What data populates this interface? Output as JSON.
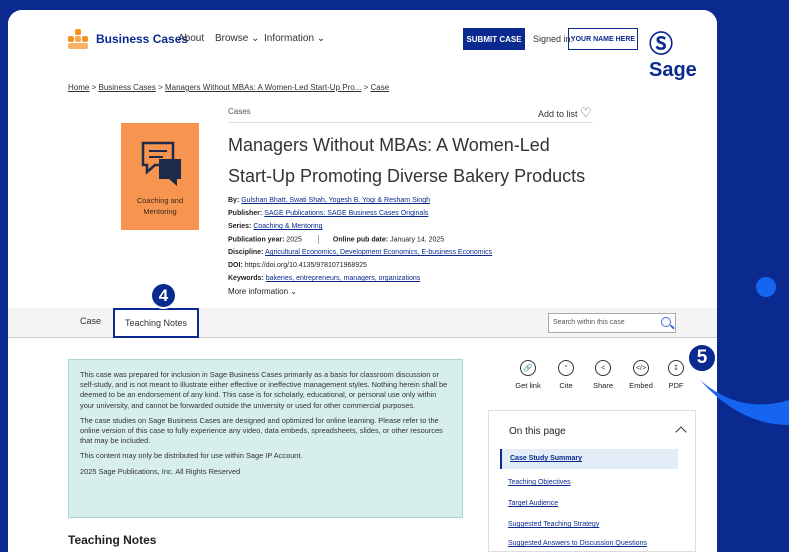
{
  "header": {
    "brand": "Business Cases",
    "nav": [
      "About",
      "Browse",
      "Information"
    ],
    "submit_label": "SUBMIT CASE",
    "signed_in_label": "Signed in:",
    "user_button": "YOUR NAME HERE",
    "sage_logo": "Sage"
  },
  "breadcrumb": {
    "home": "Home",
    "sep": ">",
    "business_cases": "Business Cases",
    "case_title": "Managers Without MBAs: A Women-Led Start-Up Pro...",
    "case": "Case"
  },
  "content": {
    "category": "Cases",
    "add_to_list": "Add to list",
    "title": "Managers Without MBAs: A Women-Led Start-Up Promoting Diverse Bakery Products",
    "cover_text": "Coaching and Mentoring",
    "by_label": "By:",
    "authors": "Gulshan Bhatt, Swati Shah, Yogesh B. Yogi & Resham Singh",
    "publisher_label": "Publisher:",
    "publisher": "SAGE Publications: SAGE Business Cases Originals",
    "series_label": "Series:",
    "series": "Coaching & Mentoring",
    "pubyear_label": "Publication year:",
    "pubyear": "2025",
    "online_label": "Online pub date:",
    "online_date": "January 14, 2025",
    "discipline_label": "Discipline:",
    "disciplines": "Agricultural Economics, Development Economics, E-business Economics",
    "doi_label": "DOI:",
    "doi": "https://doi.org/10.4135/9781071968925",
    "keywords_label": "Keywords:",
    "keywords": "bakeries, entrepreneurs, managers, organizations",
    "more_info": "More information"
  },
  "tabs": {
    "case": "Case",
    "teaching_notes": "Teaching Notes",
    "search_placeholder": "Search within this case"
  },
  "notice": {
    "p1": "This case was prepared for inclusion in Sage Business Cases primarily as a basis for classroom discussion or self-study, and is not meant to illustrate either effective or ineffective management styles. Nothing herein shall be deemed to be an endorsement of any kind. This case is for scholarly, educational, or personal use only within your university, and cannot be forwarded outside the university or used for other commercial purposes.",
    "p2": "The case studies on Sage Business Cases are designed and optimized for online learning. Please refer to the online version of this case to fully experience any video, data embeds, spreadsheets, slides, or other resources that may be included.",
    "p3": "This content may only be distributed for use within Sage IP Account.",
    "p4": "2025 Sage Publications, Inc. All Rights Reserved"
  },
  "teaching_notes_heading": "Teaching Notes",
  "tools": [
    "Get link",
    "Cite",
    "Share",
    "Embed",
    "PDF"
  ],
  "on_this_page": {
    "heading": "On this page",
    "items": [
      "Case Study Summary",
      "Teaching Objectives",
      "Target Audience",
      "Suggested Teaching Strategy",
      "Suggested Answers to Discussion Questions"
    ]
  },
  "badges": {
    "tab_badge": "4",
    "pdf_badge": "5"
  },
  "colors": {
    "brand_blue": "#0a2a8f",
    "accent_orange": "#f7944f",
    "notice_bg": "#d6efed"
  }
}
